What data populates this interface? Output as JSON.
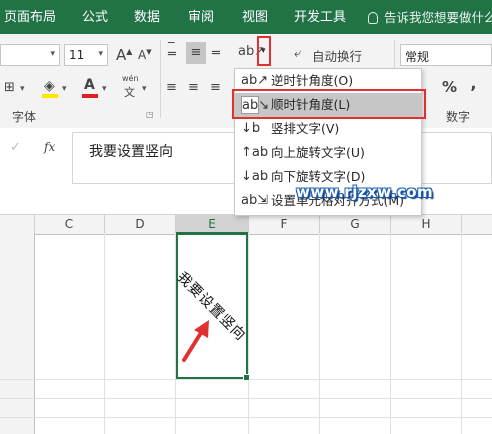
{
  "tabs": [
    "页面布局",
    "公式",
    "数据",
    "审阅",
    "视图",
    "开发工具"
  ],
  "tell_me": "告诉我您想要做什么",
  "font": {
    "size_value": "11",
    "grow_label": "A",
    "shrink_label": "A",
    "group_label": "字体",
    "phonetic_top": "wén",
    "phonetic_bottom": "文",
    "font_color_label": "A"
  },
  "alignment": {
    "wrap_text_label": "自动换行",
    "orientation_menu": [
      {
        "label": "逆时针角度(O)",
        "icon": "angle-counterclockwise-icon"
      },
      {
        "label": "顺时针角度(L)",
        "icon": "angle-clockwise-icon"
      },
      {
        "label": "竖排文字(V)",
        "icon": "vertical-text-icon"
      },
      {
        "label": "向上旋转文字(U)",
        "icon": "rotate-text-up-icon"
      },
      {
        "label": "向下旋转文字(D)",
        "icon": "rotate-text-down-icon"
      },
      {
        "label": "设置单元格对齐方式(M)",
        "icon": "format-cell-alignment-icon"
      }
    ]
  },
  "number": {
    "format_value": "常规",
    "percent_label": "%",
    "comma_label": "‚",
    "group_label": "数字"
  },
  "formula_bar": {
    "cancel_symbol": "✓",
    "fx_label": "fx",
    "content": "我要设置竖向"
  },
  "columns": [
    "C",
    "D",
    "E",
    "F",
    "G",
    "H"
  ],
  "cell_text": "我要设置竖向",
  "watermark": "www.rjzxw.com",
  "colors": {
    "accent": "#217346",
    "highlight": "#e03030",
    "arrow": "#e03030"
  }
}
